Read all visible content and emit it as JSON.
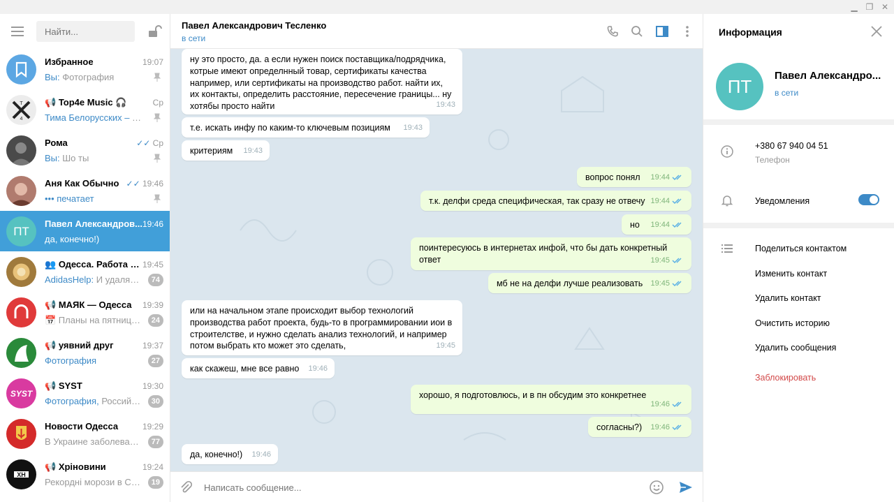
{
  "window": {
    "minimize": "▁",
    "restore": "❐",
    "close": "✕"
  },
  "sidebar": {
    "search_placeholder": "Найти...",
    "chats": [
      {
        "name": "Избранное",
        "time": "19:07",
        "who": "Вы:",
        "preview": "Фотография",
        "pinned": true,
        "avatar_color": "#5ca7e3"
      },
      {
        "name": "Top4e Music 🎧",
        "channel": true,
        "time": "Ср",
        "who": "Тима Белорусских – Я Б...",
        "preview": "",
        "pinned": true,
        "avatar_color": "#e8e8e8"
      },
      {
        "name": "Рома",
        "time": "Ср",
        "read": true,
        "who": "Вы:",
        "preview": "Шо ты",
        "pinned": true,
        "avatar_color": "#555555"
      },
      {
        "name": "Аня Как Обычно",
        "time": "19:46",
        "read": true,
        "who": "••• печатает",
        "preview": "",
        "pinned": true,
        "avatar_color": "#b07b6e"
      },
      {
        "name": "Павел Александров...",
        "time": "19:46",
        "preview": "да, конечно!)",
        "avatar_text": "ПТ",
        "active": true,
        "avatar_color": "#56c2c0"
      },
      {
        "name": "Одесса. Работа и...",
        "group": true,
        "time": "19:45",
        "who": "AdidasHelp:",
        "preview": "И удаляешь",
        "badge": "74",
        "avatar_color": "#a07a3c"
      },
      {
        "name": "МАЯК — Одесса",
        "channel": true,
        "time": "19:39",
        "preview": "📅 Планы на пятницу ...",
        "badge": "24",
        "avatar_color": "#e03a3a"
      },
      {
        "name": "уявний друг",
        "channel": true,
        "time": "19:37",
        "who": "Фотография",
        "preview": "",
        "badge": "27",
        "avatar_color": "#2a8a3a"
      },
      {
        "name": "SYST",
        "channel": true,
        "time": "19:30",
        "who": "Фотография,",
        "preview": "Российск...",
        "badge": "30",
        "avatar_color": "#d93aa0"
      },
      {
        "name": "Новости Одесса",
        "time": "19:29",
        "preview": "В Украине заболеваем...",
        "badge": "77",
        "avatar_color": "#c8a12a"
      },
      {
        "name": "Хріновини",
        "channel": true,
        "time": "19:24",
        "preview": "Рекордні морози в СШ...",
        "badge": "19",
        "avatar_color": "#111111"
      }
    ]
  },
  "chat": {
    "title": "Павел Александрович Тесленко",
    "status": "в сети",
    "composer_placeholder": "Написать сообщение...",
    "messages": [
      {
        "out": false,
        "text": "ну это просто, да. а если нужен поиск поставщика/подрядчика, котрые имеют определнный товар, сертификаты качества например,  или сертификаты на производство работ. найти их, их контакты, определить расстояние, пересечение границы... ну хотябы просто найти",
        "time": "19:43"
      },
      {
        "out": false,
        "text": "т.е. искать инфу по каким-то ключевым позициям",
        "time": "19:43"
      },
      {
        "out": false,
        "text": "критериям",
        "time": "19:43"
      },
      {
        "out": true,
        "text": "вопрос понял",
        "time": "19:44"
      },
      {
        "out": true,
        "text": "т.к. делфи среда специфическая, так сразу не отвечу",
        "time": "19:44"
      },
      {
        "out": true,
        "text": "но",
        "time": "19:44"
      },
      {
        "out": true,
        "text": "поинтересуюсь в интернетах инфой, что бы дать конкретный ответ",
        "time": "19:45"
      },
      {
        "out": true,
        "text": "мб не на делфи лучше реализовать",
        "time": "19:45"
      },
      {
        "out": false,
        "text": "или на начальном этапе происходит выбор технологий производства работ проекта, будь-то в программировании иои в строителстве, и нужно сделать анализ технологий, и например потом выбрать кто может это сделать,",
        "time": "19:45"
      },
      {
        "out": false,
        "text": "как скажеш, мне все равно",
        "time": "19:46"
      },
      {
        "out": true,
        "text": "хорошо, я подготовлюсь, и в пн обсудим это конкретнее",
        "time": "19:46"
      },
      {
        "out": true,
        "text": "согласны?)",
        "time": "19:46"
      },
      {
        "out": false,
        "text": "да, конечно!)",
        "time": "19:46"
      }
    ]
  },
  "info": {
    "title": "Информация",
    "avatar_text": "ПТ",
    "name": "Павел Александро...",
    "status": "в сети",
    "phone": "+380 67 940 04 51",
    "phone_label": "Телефон",
    "notifications_label": "Уведомления",
    "notifications_on": true,
    "actions": [
      "Поделиться контактом",
      "Изменить контакт",
      "Удалить контакт",
      "Очистить историю",
      "Удалить сообщения"
    ],
    "block_label": "Заблокировать"
  }
}
